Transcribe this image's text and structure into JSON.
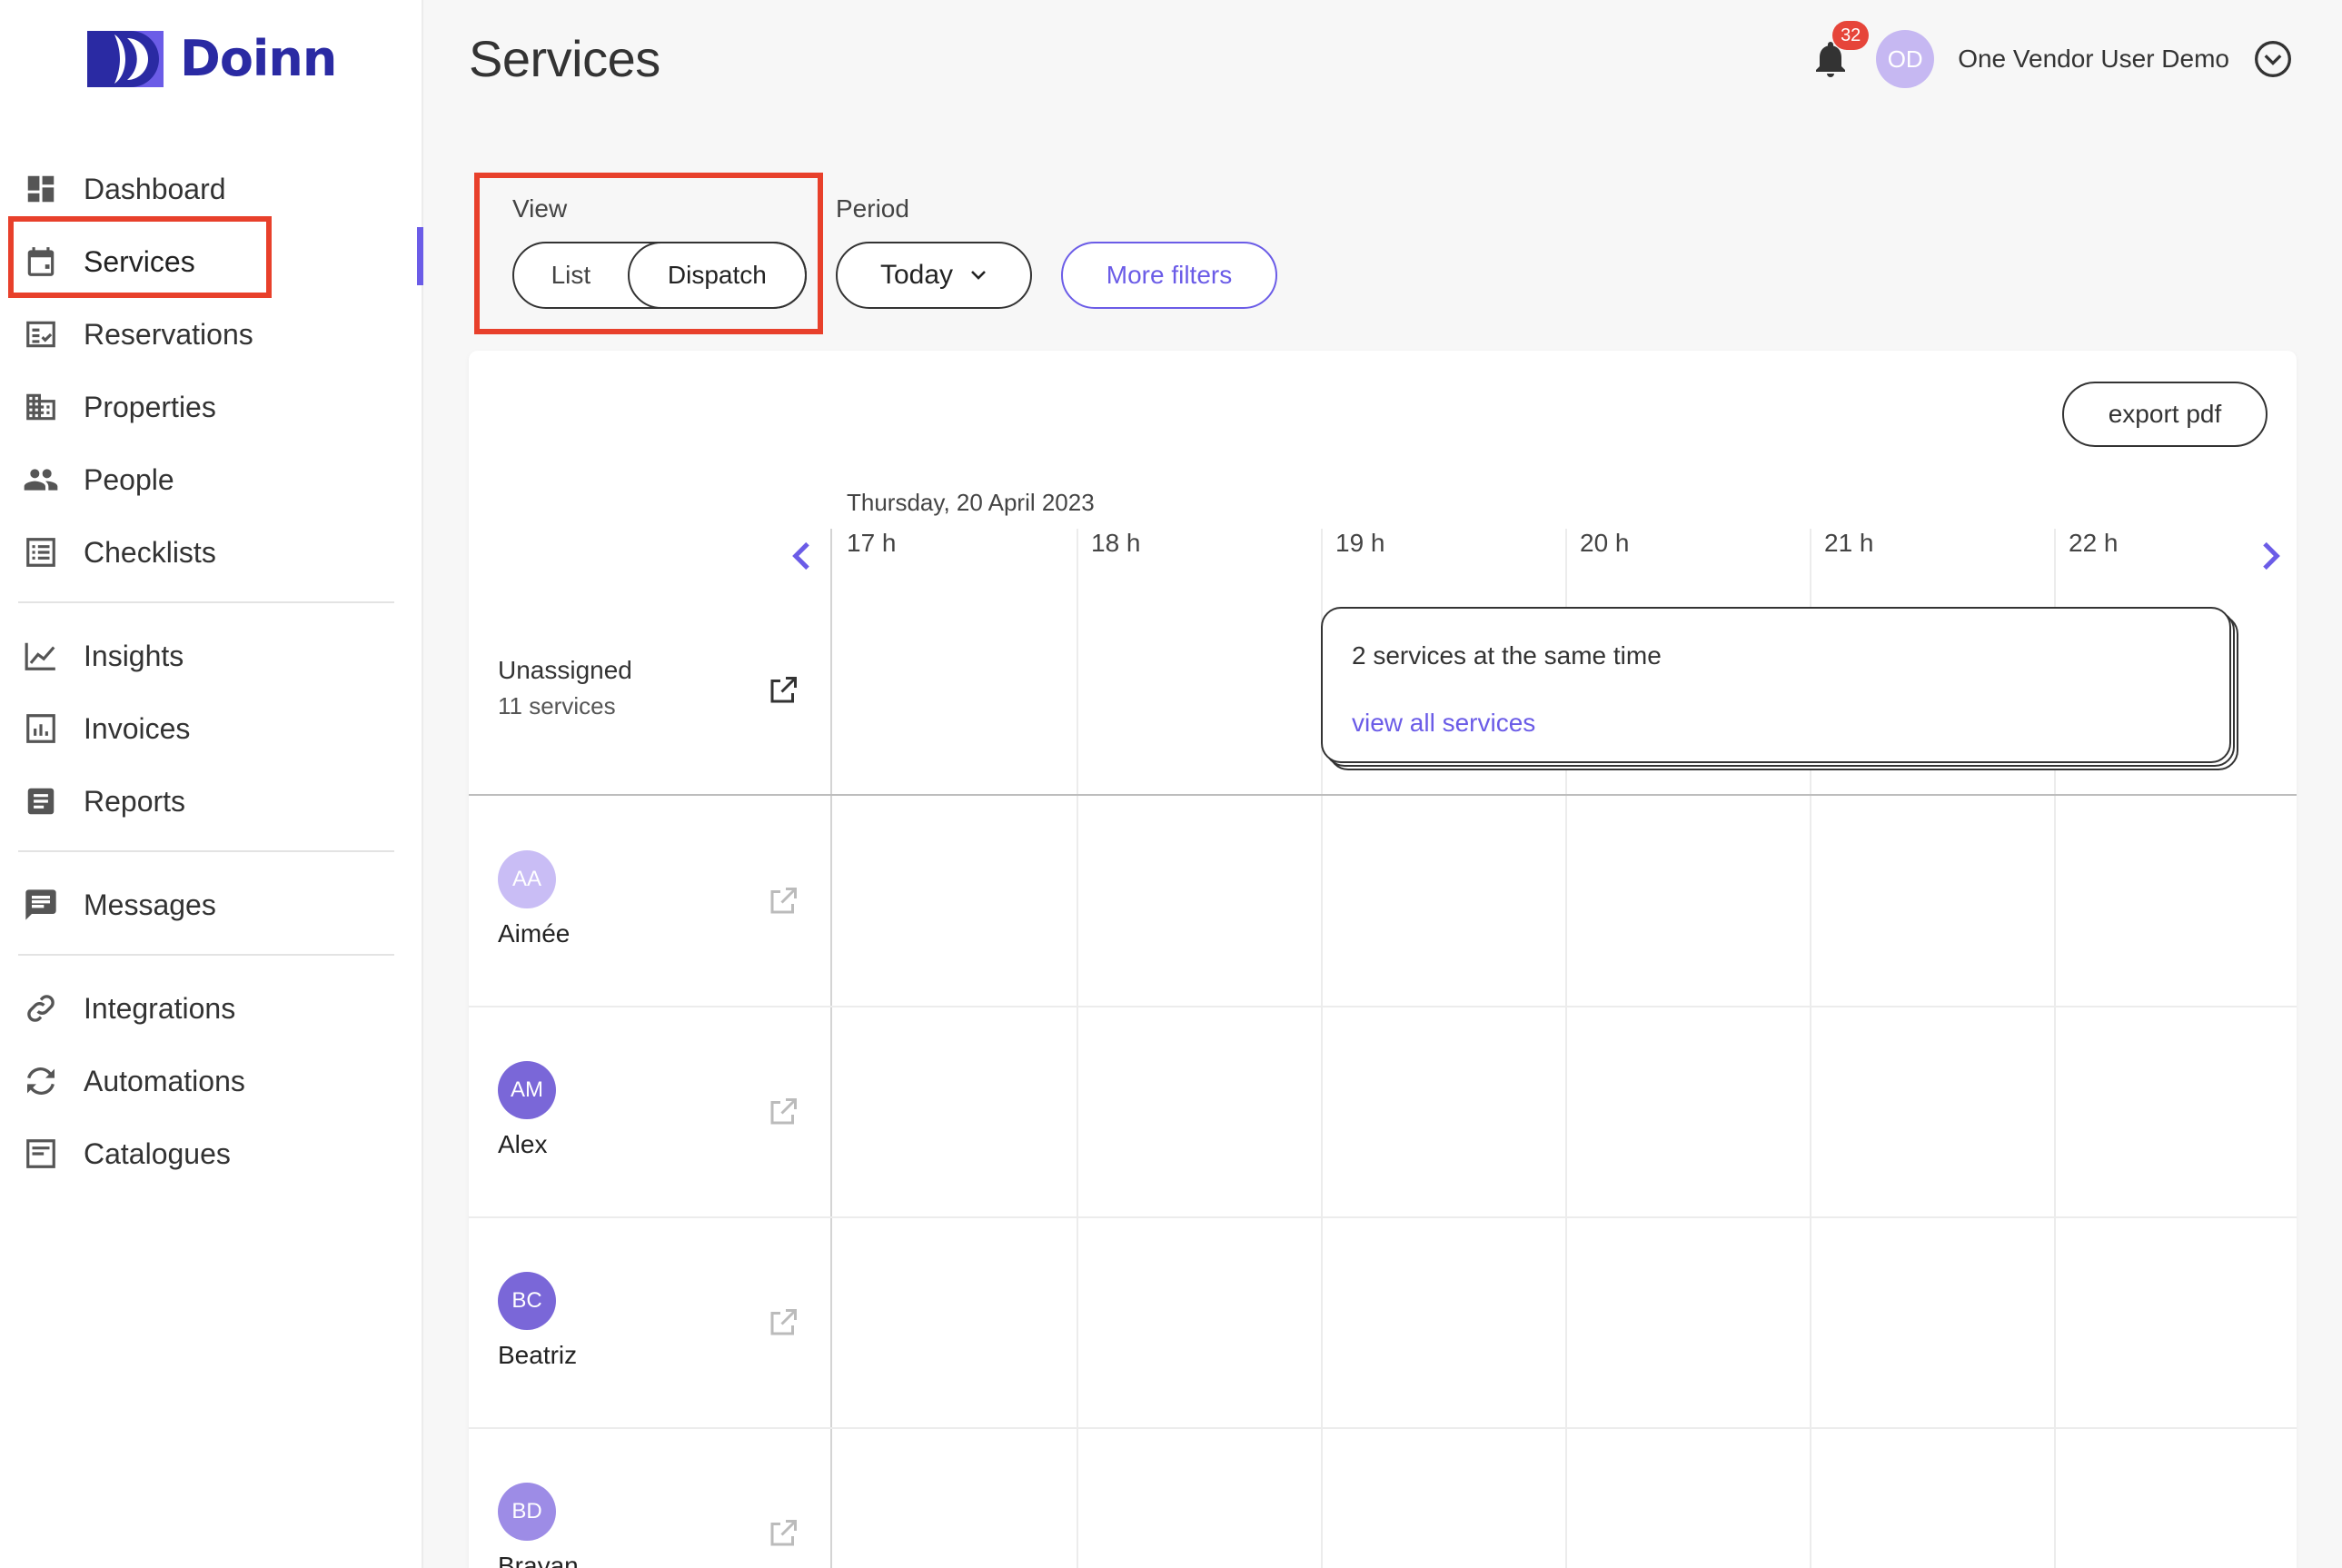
{
  "brand": {
    "name": "Doinn",
    "color": "#2a2aa3"
  },
  "sidebar": {
    "groups": [
      [
        {
          "label": "Dashboard",
          "icon": "dashboard-icon"
        },
        {
          "label": "Services",
          "icon": "calendar-icon",
          "active": true
        },
        {
          "label": "Reservations",
          "icon": "reservations-icon"
        },
        {
          "label": "Properties",
          "icon": "building-icon"
        },
        {
          "label": "People",
          "icon": "people-icon"
        },
        {
          "label": "Checklists",
          "icon": "checklist-icon"
        }
      ],
      [
        {
          "label": "Insights",
          "icon": "chart-line-icon"
        },
        {
          "label": "Invoices",
          "icon": "invoice-icon"
        },
        {
          "label": "Reports",
          "icon": "report-icon"
        }
      ],
      [
        {
          "label": "Messages",
          "icon": "message-icon"
        }
      ],
      [
        {
          "label": "Integrations",
          "icon": "link-icon"
        },
        {
          "label": "Automations",
          "icon": "sync-icon"
        },
        {
          "label": "Catalogues",
          "icon": "catalogue-icon"
        }
      ]
    ]
  },
  "header": {
    "title": "Services",
    "notifications_count": "32",
    "user_initials": "OD",
    "user_name": "One Vendor User Demo"
  },
  "filters": {
    "view_label": "View",
    "view_options": [
      "List",
      "Dispatch"
    ],
    "view_selected": "Dispatch",
    "period_label": "Period",
    "period_value": "Today",
    "more_filters_label": "More filters"
  },
  "dispatch": {
    "export_label": "export pdf",
    "date": "Thursday, 20 April 2023",
    "hours": [
      "17 h",
      "18 h",
      "19 h",
      "20 h",
      "21 h",
      "22 h"
    ],
    "unassigned": {
      "title": "Unassigned",
      "count": "11 services"
    },
    "group_card": {
      "title": "2 services at the same time",
      "link": "view all services"
    },
    "people": [
      {
        "initials": "AA",
        "name": "Aimée",
        "color": "#c9bdf5"
      },
      {
        "initials": "AM",
        "name": "Alex",
        "color": "#7a67d8"
      },
      {
        "initials": "BC",
        "name": "Beatriz",
        "color": "#7a67d8"
      },
      {
        "initials": "BD",
        "name": "Brayan",
        "color": "#9d8ce6"
      }
    ]
  },
  "colors": {
    "accent": "#6b5ce7",
    "highlight": "#e8402b",
    "badge": "#e6453a"
  }
}
